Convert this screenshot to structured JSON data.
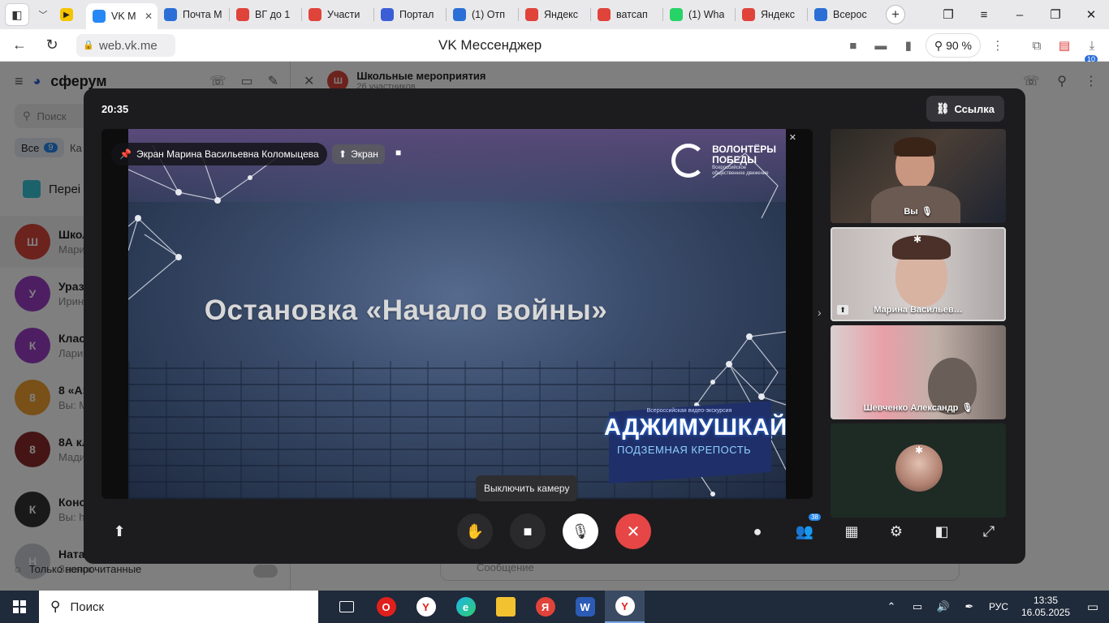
{
  "browser": {
    "tabs": [
      {
        "label": "VK М",
        "icon_color": "#2787f5",
        "active": true
      },
      {
        "label": "Почта М",
        "icon_color": "#2b6fd6"
      },
      {
        "label": "ВГ до 1",
        "icon_color": "#e0433a"
      },
      {
        "label": "Участи",
        "icon_color": "#e0433a"
      },
      {
        "label": "Портал",
        "icon_color": "#3b5ed6"
      },
      {
        "label": "(1) Отп",
        "icon_color": "#2b6fd6"
      },
      {
        "label": "Яндекс",
        "icon_color": "#e0433a"
      },
      {
        "label": "ватсап",
        "icon_color": "#e0433a"
      },
      {
        "label": "(1) Wha",
        "icon_color": "#25d366"
      },
      {
        "label": "Яндекс",
        "icon_color": "#e0433a"
      },
      {
        "label": "Всерос",
        "icon_color": "#2b6fd6"
      }
    ],
    "url": "web.vk.me",
    "page_title": "VK Мессенджер",
    "zoom": "90 %",
    "downloads_badge": "10"
  },
  "vk": {
    "brand": "сферум",
    "search_placeholder": "Поиск",
    "filter_all": "Все",
    "filter_all_count": "9",
    "filter_second": "Ка",
    "pinned_label": "Переі",
    "chats": [
      {
        "initial": "Ш",
        "color": "#d9443b",
        "name": "Школ",
        "preview": "Мари"
      },
      {
        "initial": "У",
        "color": "#9b3fc4",
        "name": "Ураз",
        "preview": "Ирин"
      },
      {
        "initial": "К",
        "color": "#9b3fc4",
        "name": "Клас",
        "preview": "Лари"
      },
      {
        "initial": "8",
        "color": "#f0a030",
        "name": "8 «А»",
        "preview": "Вы: М"
      },
      {
        "initial": "8",
        "color": "#8a2a2a",
        "name": "8А кл",
        "preview": "Мади"
      },
      {
        "initial": "К",
        "color": "#333333",
        "name": "Конс",
        "preview": "Вы: h"
      },
      {
        "initial": "Н",
        "color": "#c8ccd2",
        "name": "Ната",
        "preview": "Звонок"
      }
    ],
    "only_unread": "Только непрочитанные",
    "conversation_title": "Школьные мероприятия",
    "conversation_initial": "Ш",
    "conversation_sub": "26 участников",
    "message_placeholder": "Сообщение"
  },
  "call": {
    "time": "20:35",
    "link_button": "Ссылка",
    "pinned_screen_label": "Экран Марина Васильевна Коломыцева",
    "screen_pill": "Экран",
    "slide": {
      "title": "Остановка «Начало войны»",
      "logo_line1": "ВОЛОНТЁРЫ",
      "logo_line2": "ПОБЕДЫ",
      "logo_sub1": "Всероссийское",
      "logo_sub2": "общественное движение",
      "excursion_caption": "Всероссийская видео-экскурсия",
      "excursion_title": "АДЖИМУШКАЙ",
      "excursion_subtitle": "ПОДЗЕМНАЯ КРЕПОСТЬ"
    },
    "participants": [
      {
        "name": "Вы",
        "muted": true
      },
      {
        "name": "Марина Васильев…",
        "muted": false,
        "pinned": true,
        "sharing": true
      },
      {
        "name": "Шевченко Александр",
        "muted": true
      },
      {
        "name": "",
        "muted": true
      }
    ],
    "participants_count": "38",
    "tooltip": "Выключить камеру"
  },
  "taskbar": {
    "search": "Поиск",
    "lang": "РУС",
    "time": "13:35",
    "date": "16.05.2025"
  }
}
